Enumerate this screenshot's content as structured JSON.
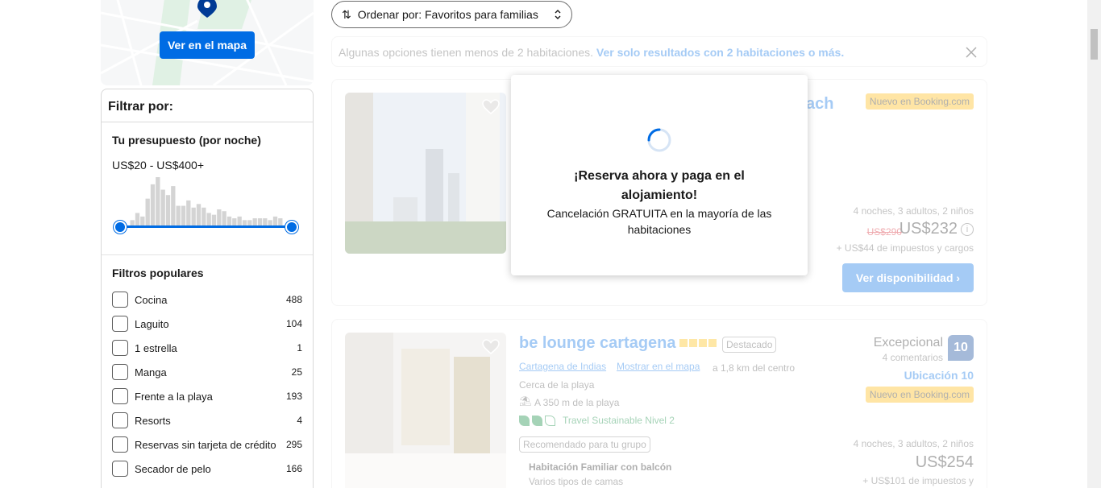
{
  "map": {
    "button_label": "Ver en el mapa"
  },
  "filters": {
    "title": "Filtrar por:",
    "budget": {
      "title": "Tu presupuesto (por noche)",
      "range": "US$20 - US$400+",
      "histogram": [
        6,
        14,
        10,
        30,
        46,
        54,
        40,
        34,
        44,
        22,
        22,
        28,
        20,
        24,
        20,
        14,
        12,
        18,
        16,
        10,
        8,
        10,
        6,
        6,
        8,
        8,
        8,
        6,
        10,
        8
      ],
      "min_value": 20,
      "max_value": 400
    },
    "popular": {
      "title": "Filtros populares",
      "items": [
        {
          "label": "Cocina",
          "count": "488"
        },
        {
          "label": "Laguito",
          "count": "104"
        },
        {
          "label": "1 estrella",
          "count": "1"
        },
        {
          "label": "Manga",
          "count": "25"
        },
        {
          "label": "Frente a la playa",
          "count": "193"
        },
        {
          "label": "Resorts",
          "count": "4"
        },
        {
          "label": "Reservas sin tarjeta de crédito",
          "count": "295"
        },
        {
          "label": "Secador de pelo",
          "count": "166"
        }
      ]
    }
  },
  "sort": {
    "label": "Ordenar por: Favoritos para familias"
  },
  "notice": {
    "text": "Algunas opciones tienen menos de 2 habitaciones.",
    "link": "Ver solo resultados con 2 habitaciones o más."
  },
  "cards": [
    {
      "title_tail": "ach",
      "badge": "Nuevo en Booking.com",
      "stay": "4 noches, 3 adultos, 2 niños",
      "price_old": "US$290",
      "price": "US$232",
      "taxes": "+ US$44 de impuestos y cargos",
      "cta": "Ver disponibilidad"
    },
    {
      "title": "be lounge cartagena",
      "featured": "Destacado",
      "city_link": "Cartagena de Indias",
      "map_link": "Mostrar en el mapa",
      "distance": "a 1,8 km del centro",
      "near": "Cerca de la playa",
      "beach": "A 350 m de la playa",
      "sustainable": "Travel Sustainable Nivel 2",
      "recommended": "Recomendado para tu grupo",
      "room": "Habitación Familiar con balcón",
      "room_sub": "Varios tipos de camas",
      "score_label": "Excepcional",
      "reviews": "4 comentarios",
      "score": "10",
      "location": "Ubicación 10",
      "badge": "Nuevo en Booking.com",
      "stay": "4 noches, 3 adultos, 2 niños",
      "price": "US$254",
      "taxes": "+ US$101 de impuestos y"
    }
  ],
  "modal": {
    "title": "¡Reserva ahora y paga en el alojamiento!",
    "subtitle": "Cancelación GRATUITA en la mayoría de las habitaciones"
  }
}
